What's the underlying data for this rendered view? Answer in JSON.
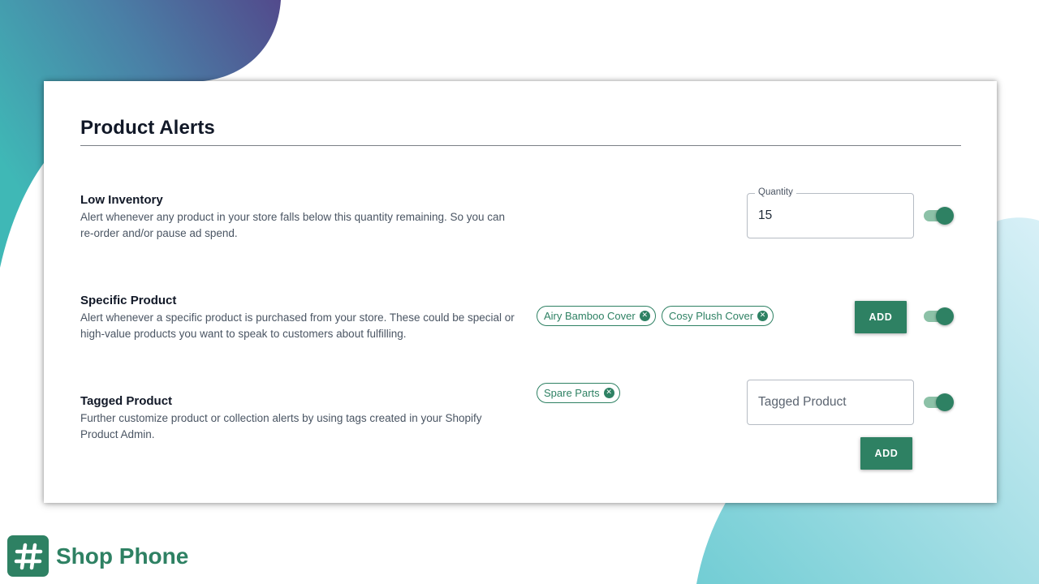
{
  "page": {
    "title": "Product Alerts"
  },
  "colors": {
    "accent": "#2e8163",
    "toggle_track": "#8cc1a7",
    "blob_teal": "#3fb6b4",
    "blob_indigo": "#514c8e",
    "blob_light": "#7dd0d8"
  },
  "low_inventory": {
    "title": "Low Inventory",
    "description": "Alert whenever any product in your store falls below this quantity remaining. So you can re-order and/or pause ad spend.",
    "quantity_label": "Quantity",
    "quantity_value": "15",
    "enabled": true
  },
  "specific_product": {
    "title": "Specific Product",
    "description": "Alert whenever a specific product is purchased from your store. These could be special or high-value products you want to speak to customers about fulfilling.",
    "chips": [
      "Airy Bamboo Cover",
      "Cosy Plush Cover"
    ],
    "add_label": "ADD",
    "enabled": true
  },
  "tagged_product": {
    "title": "Tagged Product",
    "description": "Further customize product or collection alerts by using tags created in your Shopify Product Admin.",
    "chips": [
      "Spare Parts"
    ],
    "input_placeholder": "Tagged Product",
    "add_label": "ADD",
    "enabled": true
  },
  "brand": {
    "name": "Shop Phone",
    "logo_icon": "hash-icon"
  }
}
